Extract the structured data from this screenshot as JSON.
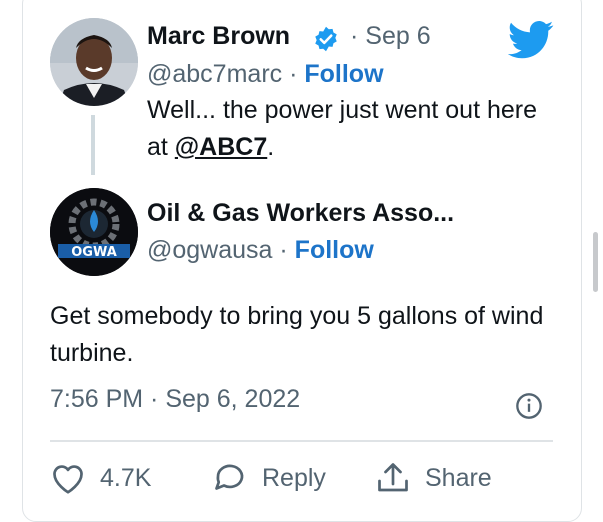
{
  "colors": {
    "accent": "#1d74c9",
    "twitter_blue": "#1d9bf0",
    "muted": "#536471",
    "text": "#0f1419"
  },
  "tweet": {
    "author": {
      "name": "Marc Brown",
      "handle": "@abc7marc",
      "date": "Sep 6",
      "follow_label": "Follow",
      "verified_icon": "verified-badge-icon"
    },
    "text_before": "Well... the power just went out here at ",
    "mention": "@ABC7",
    "text_after": "."
  },
  "reply": {
    "author": {
      "name": "Oil & Gas Workers Asso...",
      "handle": "@ogwausa",
      "follow_label": "Follow",
      "avatar_text": "OGWA"
    },
    "text": "Get somebody to bring you 5 gallons of wind turbine.",
    "timestamp": "7:56 PM · Sep 6, 2022",
    "actions": {
      "like_count": "4.7K",
      "reply_label": "Reply",
      "share_label": "Share"
    }
  },
  "icons": [
    "twitter-bird-icon",
    "info-icon",
    "heart-icon",
    "speech-bubble-icon",
    "share-icon"
  ]
}
